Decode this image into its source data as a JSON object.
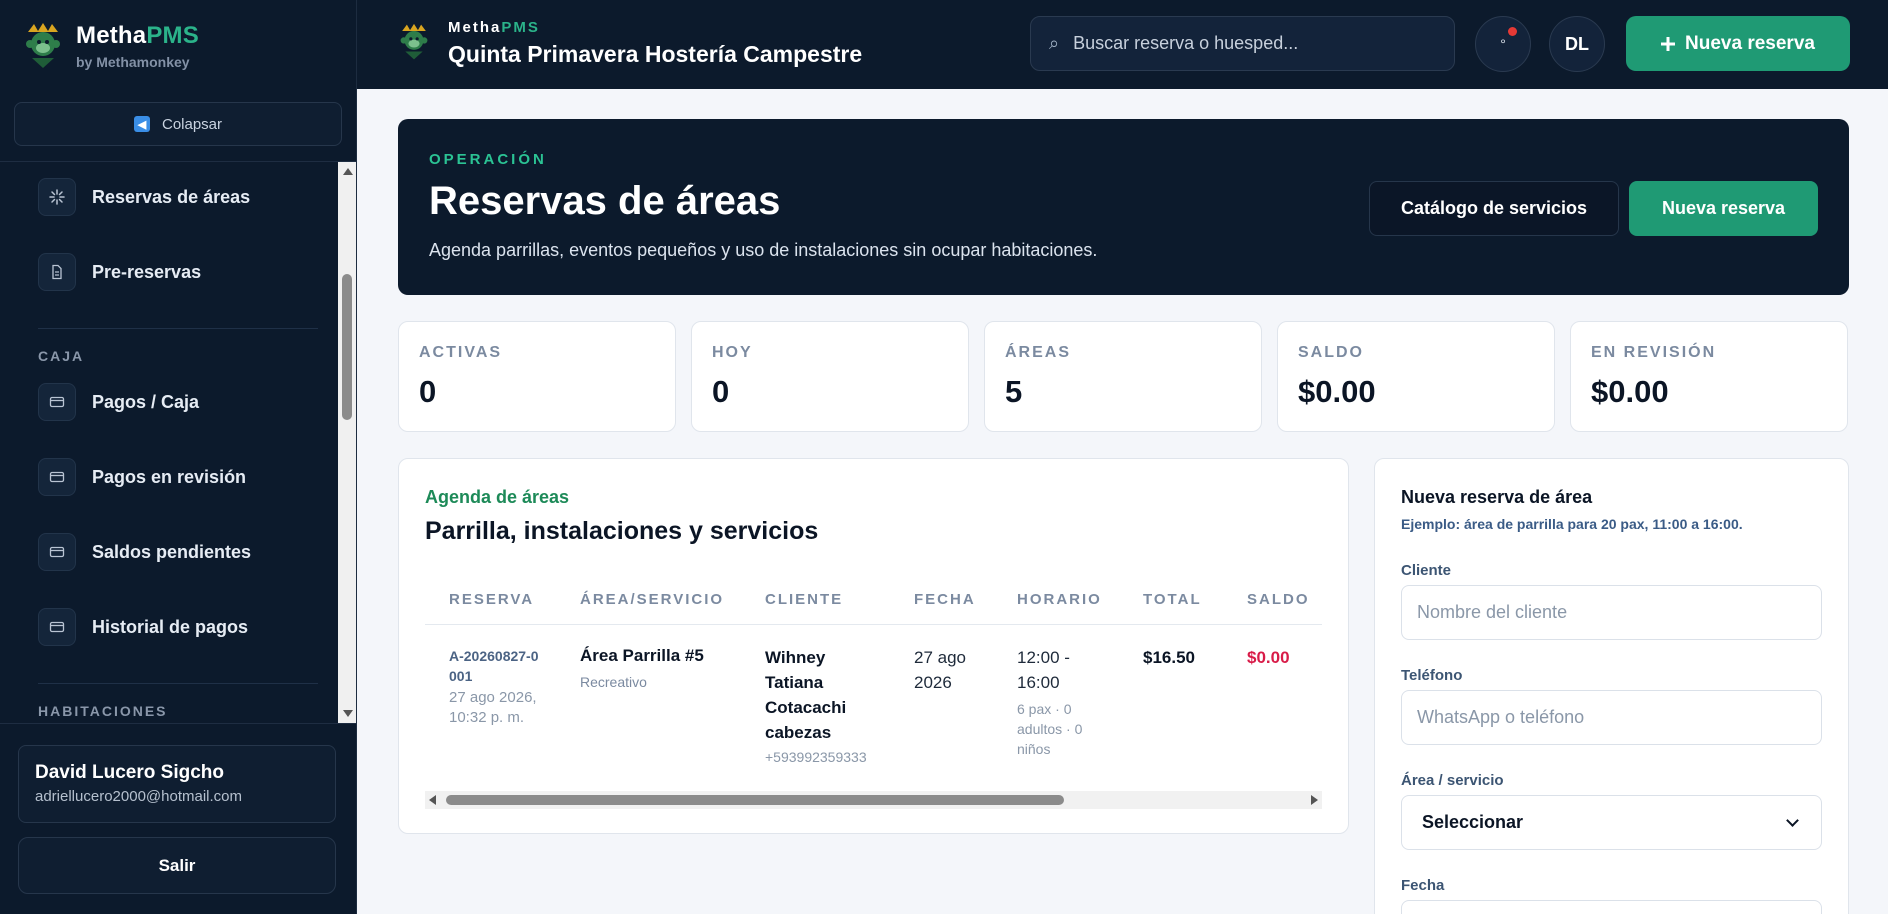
{
  "brand": {
    "name_main": "Metha",
    "name_accent": "PMS",
    "tagline": "by Methamonkey"
  },
  "sidebar": {
    "collapse_label": "Colapsar",
    "items": [
      {
        "label": "Reservas de áreas",
        "icon": "sparkle-icon"
      },
      {
        "label": "Pre-reservas",
        "icon": "document-icon"
      },
      {
        "label": "Pagos / Caja",
        "icon": "card-icon"
      },
      {
        "label": "Pagos en revisión",
        "icon": "card-icon"
      },
      {
        "label": "Saldos pendientes",
        "icon": "card-icon"
      },
      {
        "label": "Historial de pagos",
        "icon": "card-icon"
      }
    ],
    "sections": {
      "caja": "CAJA",
      "habitaciones": "HABITACIONES"
    }
  },
  "user": {
    "name": "David Lucero Sigcho",
    "email": "adriellucero2000@hotmail.com",
    "logout_label": "Salir"
  },
  "topbar": {
    "brand_main": "Metha",
    "brand_accent": "PMS",
    "property_name": "Quinta Primavera Hostería Campestre",
    "search_placeholder": "Buscar reserva o huesped...",
    "search_icon": "⌕",
    "notif_glyph": "°",
    "avatar_initials": "DL",
    "new_booking_label": "Nueva reserva"
  },
  "hero": {
    "kicker": "OPERACIÓN",
    "title": "Reservas de áreas",
    "description": "Agenda parrillas, eventos pequeños y uso de instalaciones sin ocupar habitaciones.",
    "catalog_label": "Catálogo de servicios",
    "new_label": "Nueva reserva"
  },
  "stats": [
    {
      "label": "ACTIVAS",
      "value": "0"
    },
    {
      "label": "HOY",
      "value": "0"
    },
    {
      "label": "ÁREAS",
      "value": "5"
    },
    {
      "label": "SALDO",
      "value": "$0.00"
    },
    {
      "label": "EN REVISIÓN",
      "value": "$0.00"
    }
  ],
  "agenda": {
    "kicker": "Agenda de áreas",
    "title": "Parrilla, instalaciones y servicios",
    "columns": [
      "RESERVA",
      "ÁREA/SERVICIO",
      "CLIENTE",
      "FECHA",
      "HORARIO",
      "TOTAL",
      "SALDO"
    ],
    "rows": [
      {
        "id": "A-20260827-0001",
        "created": "27 ago 2026, 10:32 p. m.",
        "area": "Área Parrilla #5",
        "area_type": "Recreativo",
        "client": "Wihney Tatiana Cotacachi cabezas",
        "phone": "+593992359333",
        "date": "27 ago 2026",
        "time": "12:00 - 16:00",
        "guests": "6 pax · 0 adultos · 0 niños",
        "total": "$16.50",
        "balance": "$0.00"
      }
    ]
  },
  "form": {
    "title": "Nueva reserva de área",
    "hint": "Ejemplo: área de parrilla para 20 pax, 11:00 a 16:00.",
    "client_label": "Cliente",
    "client_placeholder": "Nombre del cliente",
    "phone_label": "Teléfono",
    "phone_placeholder": "WhatsApp o teléfono",
    "area_label": "Área / servicio",
    "area_selected": "Seleccionar",
    "date_label": "Fecha"
  },
  "colors": {
    "primary": "#1f9a74",
    "dark": "#0c1a2c",
    "accent_green": "#2bb38a",
    "danger": "#d81b48"
  }
}
